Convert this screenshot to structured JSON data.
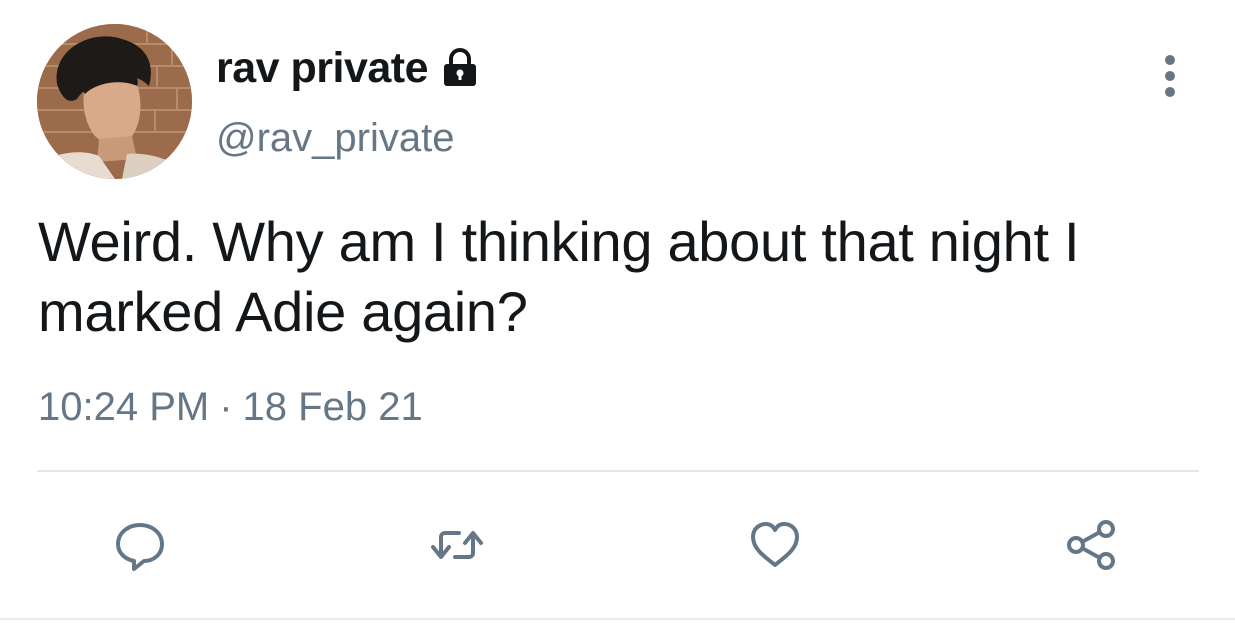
{
  "tweet": {
    "display_name": "rav private",
    "handle": "@rav_private",
    "text": "Weird. Why am I thinking about that night I marked Adie again?",
    "time": "10:24 PM",
    "separator": "·",
    "date": "18 Feb 21",
    "protected": true
  },
  "icons": {
    "lock": "lock-icon",
    "more": "more-vertical-icon",
    "reply": "reply-icon",
    "retweet": "retweet-icon",
    "like": "heart-icon",
    "share": "share-icon"
  },
  "colors": {
    "text_primary": "#14171a",
    "text_secondary": "#657786",
    "icon": "#657786",
    "divider": "#e1e8ed"
  }
}
